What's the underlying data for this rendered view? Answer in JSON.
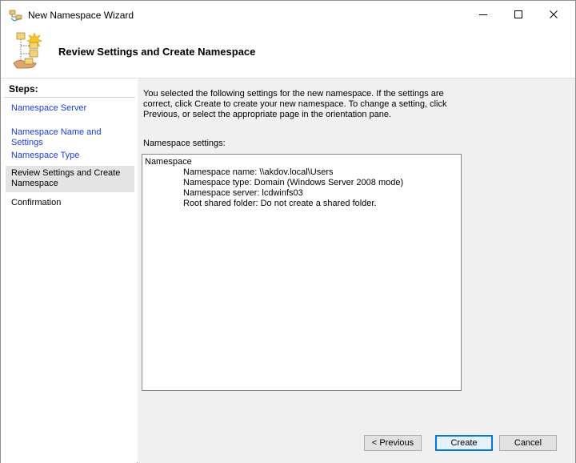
{
  "window": {
    "title": "New Namespace Wizard",
    "icon": "namespace-wizard-icon"
  },
  "header": {
    "title": "Review Settings and Create Namespace",
    "icon": "namespace-tree-icon"
  },
  "steps": {
    "heading": "Steps:",
    "items": [
      {
        "label": "Namespace Server",
        "state": "link"
      },
      {
        "label": "Namespace Name and Settings",
        "state": "link"
      },
      {
        "label": "Namespace Type",
        "state": "link"
      },
      {
        "label": "Review Settings and Create Namespace",
        "state": "current"
      },
      {
        "label": "Confirmation",
        "state": "plain"
      }
    ]
  },
  "content": {
    "intro": "You selected the following settings for the new namespace. If the settings are correct, click Create to create your new namespace. To change a setting, click Previous, or select the appropriate page in the orientation pane.",
    "settings_label": "Namespace settings:",
    "settings": {
      "group": "Namespace",
      "rows": [
        "Namespace name: \\\\akdov.local\\Users",
        "Namespace type:  Domain (Windows Server 2008 mode)",
        "Namespace server: lcdwinfs03",
        "Root shared folder:  Do not create a shared folder."
      ]
    }
  },
  "buttons": {
    "previous": "< Previous",
    "create": "Create",
    "cancel": "Cancel"
  }
}
